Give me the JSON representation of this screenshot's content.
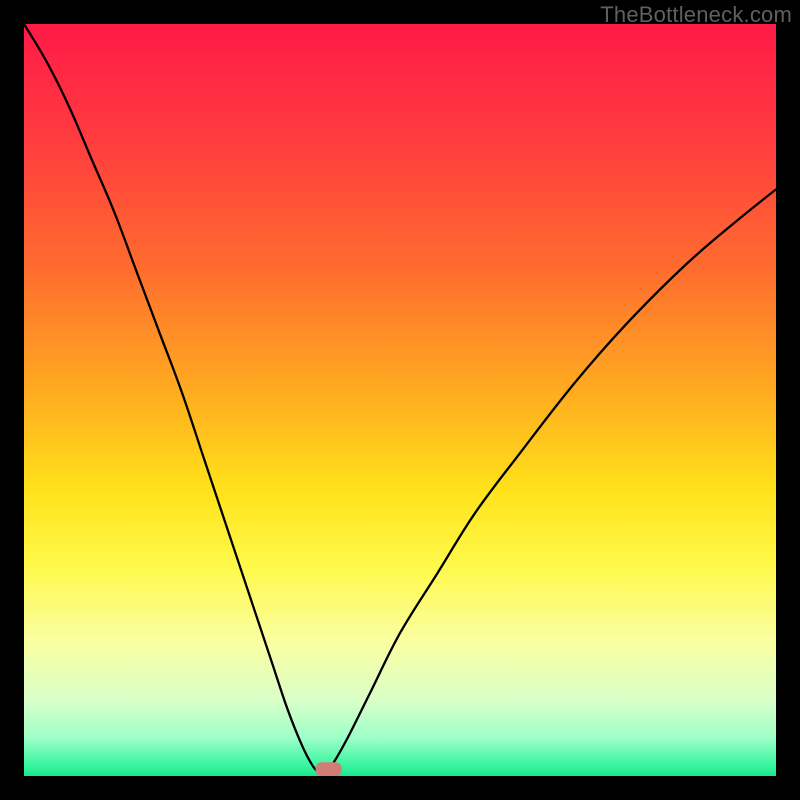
{
  "watermark": "TheBottleneck.com",
  "chart_data": {
    "type": "line",
    "title": "",
    "xlabel": "",
    "ylabel": "",
    "xlim": [
      0,
      100
    ],
    "ylim": [
      0,
      100
    ],
    "grid": false,
    "legend": false,
    "annotations": [],
    "series": [
      {
        "name": "curve",
        "x": [
          0,
          3,
          6,
          9,
          12,
          15,
          18,
          21,
          24,
          27,
          30,
          33,
          35,
          37,
          38.5,
          39.5,
          40,
          41,
          43,
          46,
          50,
          55,
          60,
          66,
          73,
          80,
          88,
          95,
          100
        ],
        "values": [
          100,
          95,
          89,
          82,
          75,
          67,
          59,
          51,
          42,
          33,
          24,
          15,
          9,
          4,
          1.2,
          0.3,
          0.3,
          1.5,
          5,
          11,
          19,
          27,
          35,
          43,
          52,
          60,
          68,
          74,
          78
        ]
      }
    ],
    "marker": {
      "x": 40.5,
      "y": 0.9,
      "color": "#d07d78"
    },
    "background_gradient": {
      "stops": [
        {
          "offset": 0.0,
          "color": "#ff1a47"
        },
        {
          "offset": 0.15,
          "color": "#ff3b3f"
        },
        {
          "offset": 0.32,
          "color": "#ff6a2f"
        },
        {
          "offset": 0.5,
          "color": "#ffb01f"
        },
        {
          "offset": 0.62,
          "color": "#ffe21a"
        },
        {
          "offset": 0.72,
          "color": "#fff94a"
        },
        {
          "offset": 0.82,
          "color": "#faffa0"
        },
        {
          "offset": 0.9,
          "color": "#d9ffc8"
        },
        {
          "offset": 0.95,
          "color": "#9cffc8"
        },
        {
          "offset": 0.985,
          "color": "#3cf5a0"
        },
        {
          "offset": 1.0,
          "color": "#17e88d"
        }
      ]
    }
  }
}
